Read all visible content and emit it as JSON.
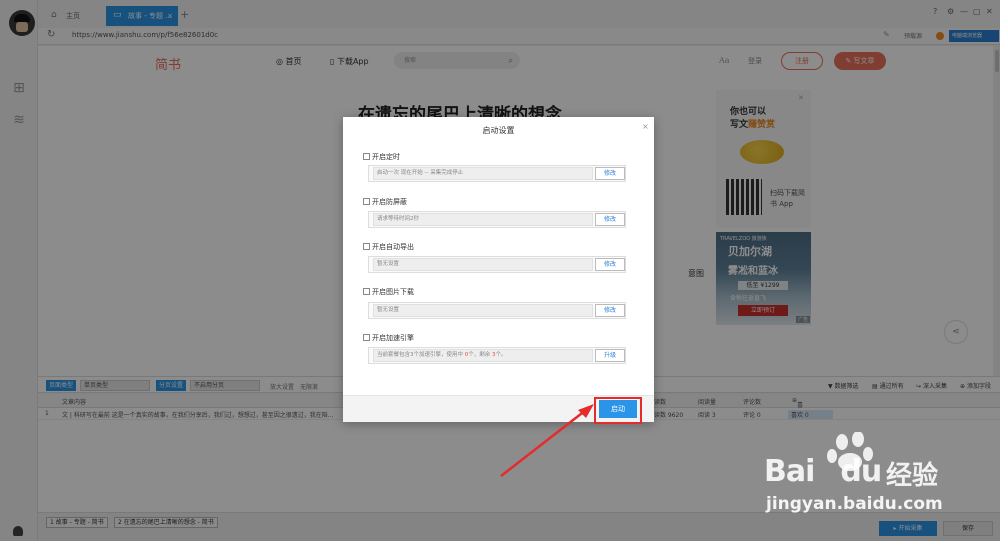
{
  "tabs": {
    "home_label": "主页",
    "active_label": "故事 - 专题 ...",
    "active_close": "×",
    "new_tab": "+"
  },
  "address": {
    "url": "https://www.jianshu.com/p/f56e82601d0c",
    "link_text": "预载源",
    "user_label": "电脑端浏览器"
  },
  "site": {
    "logo": "简书",
    "nav_home": "首页",
    "nav_download": "下载App",
    "search_placeholder": "搜索",
    "aa": "Aa",
    "login": "登录",
    "register": "注册",
    "write": "写文章",
    "article_title": "在遗忘的尾巴上清晰的想念",
    "peek_text": "意图"
  },
  "ads": {
    "ad1_line1": "你也可以",
    "ad1_line2_a": "写文",
    "ad1_line2_b": "赚赞赏",
    "qr_caption": "扫码下载简书 App",
    "ad2_brand": "TRAVELZOO 旅游族",
    "ad2_title": "贝加尔湖",
    "ad2_subtitle": "雾凇和蓝冰",
    "ad2_price": "低至 ¥1299",
    "ad2_note": "含税往返直飞",
    "ad2_button": "立即预订",
    "ad2_tag": "广告"
  },
  "toolbar": {
    "page_type_label": "页面类型",
    "page_type_value": "单页类型",
    "paging_label": "分页设置",
    "paging_value": "不启用分页",
    "link_collect": "放大设置",
    "link_load": "无限滚",
    "filter": "数据筛选",
    "dedupe": "通过所有",
    "deep_collect": "深入采集",
    "add_field": "添加字段"
  },
  "table": {
    "headers": [
      "文章内容",
      "阅读数",
      "阅读量",
      "评论数",
      "喜欢数"
    ],
    "row_index": "1",
    "row_text": "文 | 科研写在最前 这是一个真实的故事，在我们分享后，我们过，想想过，甚至因之很遗过，我在陪...",
    "row_reads": "阅读数 9620",
    "row_views": "阅读 3",
    "row_comments": "评论 0",
    "row_likes": "喜欢 0"
  },
  "bottom": {
    "tab1": "1 故事 - 专题 - 简书",
    "tab2": "2 在遗忘的尾巴上清晰的想念 - 简书",
    "start_collect": "▸ 开始采集",
    "save": "保存"
  },
  "modal": {
    "title": "启动设置",
    "close": "×",
    "sections": [
      {
        "label": "开启定时",
        "field": "启动一次 现在开始 -- 采集完成停止",
        "button": "修改"
      },
      {
        "label": "开启防屏蔽",
        "field": "请求等待时间2秒",
        "button": "修改"
      },
      {
        "label": "开启自动导出",
        "field": "暂无设置",
        "button": "修改"
      },
      {
        "label": "开启图片下载",
        "field": "暂无设置",
        "button": "修改"
      },
      {
        "label": "开启加速引擎",
        "field_a": "当前套餐包含3个加速引擎，使用中 ",
        "field_b": "0",
        "field_c": "个，剩余 ",
        "field_d": "3",
        "field_e": "个。",
        "button": "升级"
      }
    ],
    "start_button": "启动"
  },
  "watermark": {
    "brand": "Bai",
    "brand2": "du",
    "cn": "经验",
    "url": "jingyan.baidu.com"
  },
  "colors": {
    "accent": "#2a95e8",
    "jianshu": "#ea6f5a",
    "highlight": "#e52b2b"
  }
}
